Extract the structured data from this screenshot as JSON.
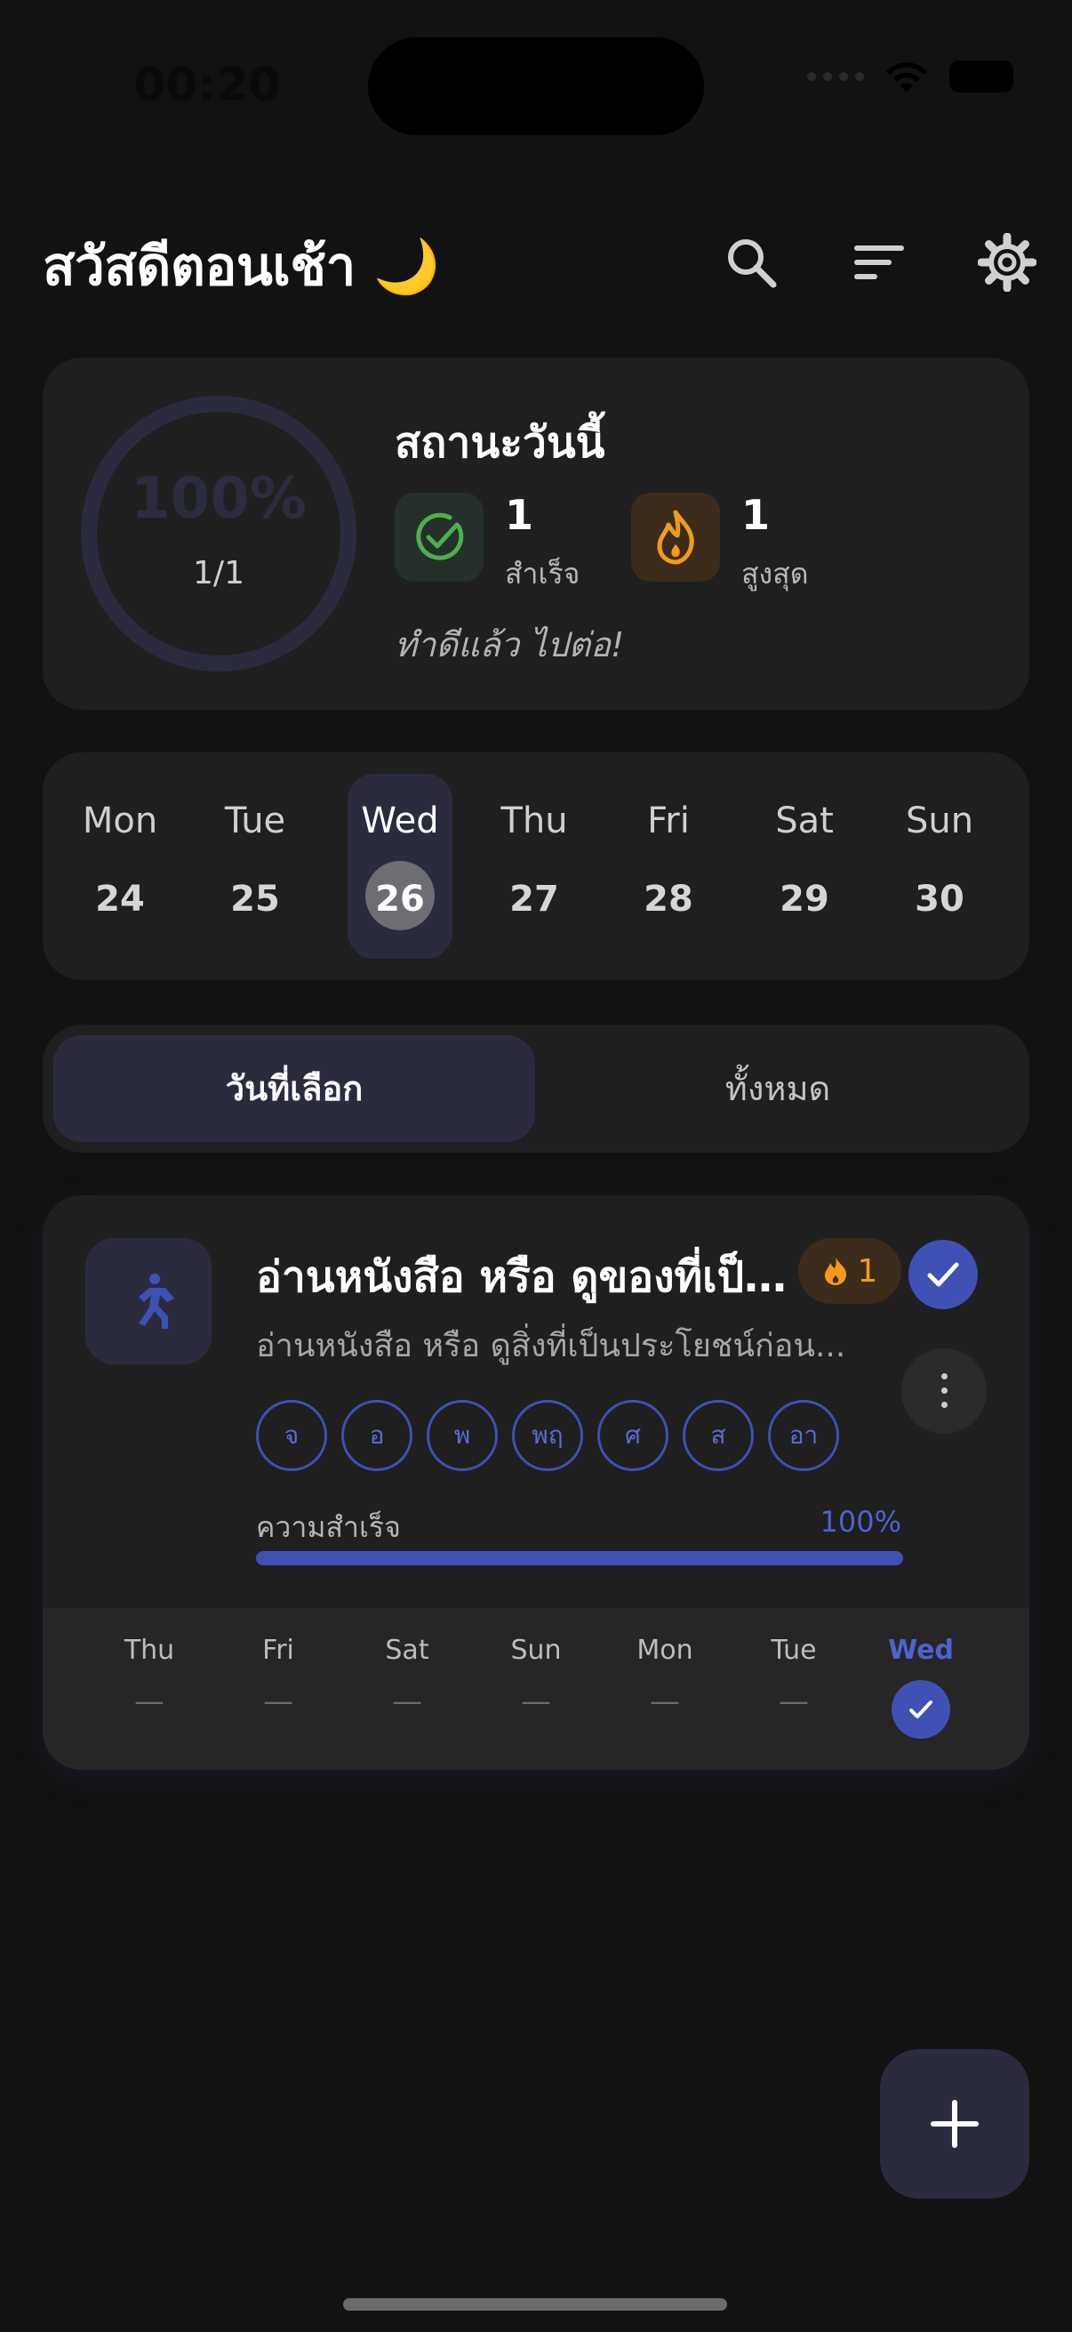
{
  "status_bar": {
    "time": "00:20"
  },
  "header": {
    "greeting": "สวัสดีตอนเช้า 🌙"
  },
  "today_status": {
    "title": "สถานะวันนี้",
    "ring_percent": "100%",
    "ring_fraction": "1/1",
    "completed": {
      "value": "1",
      "label": "สำเร็จ"
    },
    "best_streak": {
      "value": "1",
      "label": "สูงสุด"
    },
    "message": "ทำดีแล้ว ไปต่อ!",
    "colors": {
      "check_bg": "#26302a",
      "check": "#4caf50",
      "fire_bg": "#3b2c1c",
      "fire": "#f39a1e"
    }
  },
  "week": {
    "days": [
      {
        "name": "Mon",
        "num": "24"
      },
      {
        "name": "Tue",
        "num": "25"
      },
      {
        "name": "Wed",
        "num": "26"
      },
      {
        "name": "Thu",
        "num": "27"
      },
      {
        "name": "Fri",
        "num": "28"
      },
      {
        "name": "Sat",
        "num": "29"
      },
      {
        "name": "Sun",
        "num": "30"
      }
    ],
    "selected_index": 2
  },
  "tabs": {
    "selected": "วันที่เลือก",
    "all": "ทั้งหมด"
  },
  "habit": {
    "icon": "run-icon",
    "title": "อ่านหนังสือ หรือ ดูของที่เป็...",
    "description": "อ่านหนังสือ หรือ ดูสิ่งที่เป็นประโยชน์ก่อน...",
    "streak": "1",
    "weekdays": [
      "จ",
      "อ",
      "พ",
      "พฤ",
      "ศ",
      "ส",
      "อา"
    ],
    "progress_label": "ความสำเร็จ",
    "progress_percent": "100%",
    "progress_value": 1.0,
    "accent": "#3f51b5",
    "history": [
      {
        "name": "Thu",
        "mark": "—"
      },
      {
        "name": "Fri",
        "mark": "—"
      },
      {
        "name": "Sat",
        "mark": "—"
      },
      {
        "name": "Sun",
        "mark": "—"
      },
      {
        "name": "Mon",
        "mark": "—"
      },
      {
        "name": "Tue",
        "mark": "—"
      },
      {
        "name": "Wed",
        "mark": "done"
      }
    ]
  }
}
